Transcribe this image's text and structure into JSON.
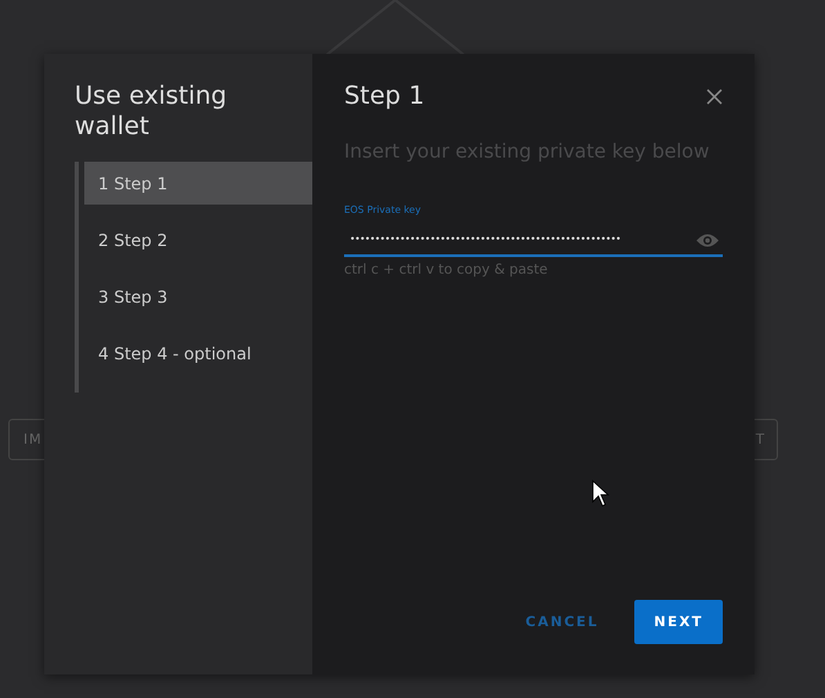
{
  "background": {
    "buttons": [
      "IM",
      "T"
    ]
  },
  "dialog": {
    "title": "Use existing wallet",
    "steps": [
      {
        "label": "1 Step 1",
        "selected": true
      },
      {
        "label": "2 Step 2",
        "selected": false
      },
      {
        "label": "3 Step 3",
        "selected": false
      },
      {
        "label": "4 Step 4 - optional",
        "selected": false
      }
    ],
    "heading": "Step 1",
    "instruction": "Insert your existing private key below",
    "field": {
      "label": "EOS Private key",
      "value": "••••••••••••••••••••••••••••••••••••••••••••••••••••••",
      "hint": "ctrl c + ctrl v to copy & paste"
    },
    "buttons": [
      {
        "label": "CANCEL",
        "kind": "flat"
      },
      {
        "label": "NEXT",
        "kind": "primary"
      }
    ]
  }
}
